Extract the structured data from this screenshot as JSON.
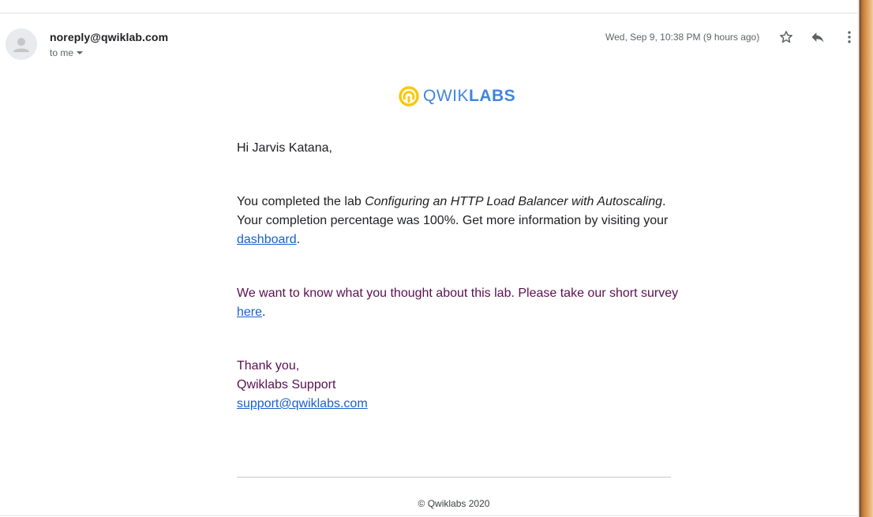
{
  "email": {
    "sender": "noreply@qwiklab.com",
    "recipient": "to me",
    "datetime": "Wed, Sep 9, 10:38 PM (9 hours ago)"
  },
  "icons": {
    "avatar": "person-avatar-icon",
    "star": "star-icon",
    "reply": "reply-icon",
    "more": "more-vertical-icon",
    "recipient_menu": "caret-down-icon",
    "logo": "qwiklabs-logo-icon"
  },
  "logo": {
    "part1": "QWIK",
    "part2": "LABS"
  },
  "message": {
    "greeting": "Hi Jarvis Katana,",
    "completion_intro": "You completed the lab ",
    "lab_name": "Configuring an HTTP Load Balancer with Autoscaling",
    "completion_rest": ". Your completion percentage was 100%. Get more information by visiting your ",
    "dashboard_link": "dashboard",
    "period1": ".",
    "survey_text": "We want to know what you thought about this lab. Please take our short survey ",
    "survey_link": "here",
    "period2": ".",
    "thanks": "Thank you,",
    "team": "Qwiklabs Support",
    "support_email": "support@qwiklabs.com"
  },
  "footer": {
    "copyright": "© Qwiklabs 2020"
  },
  "colors": {
    "link": "#1a5fcc",
    "brand_blue": "#3f85de",
    "brand_yellow": "#f9c80e",
    "survey_text": "#5b0f52"
  }
}
